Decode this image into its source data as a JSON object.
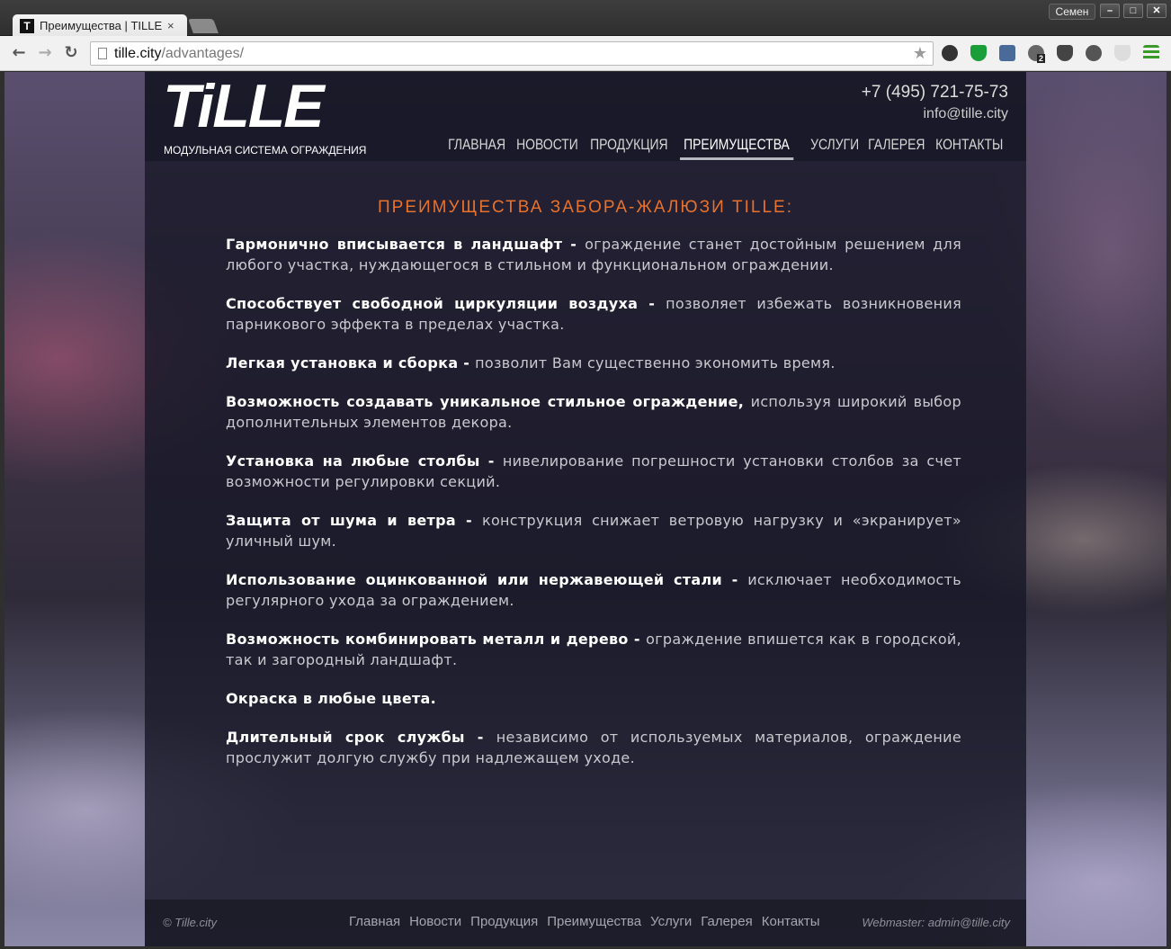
{
  "browser": {
    "tab_title": "Преимущества | TILLE",
    "tab_favicon": "T",
    "tab_close": "×",
    "user_name": "Семен",
    "url_host": "tille.city",
    "url_path": "/advantages/",
    "window_buttons": {
      "minimize": "–",
      "maximize": "□",
      "close": "✕"
    },
    "nav": {
      "back": "←",
      "forward": "→",
      "reload": "↻"
    },
    "star": "★",
    "extension_badge": "2"
  },
  "site": {
    "logo": "TiLLE",
    "slogan": "МОДУЛЬНАЯ СИСТЕМА ОГРАЖДЕНИЯ",
    "phone": "+7 (495) 721-75-73",
    "email": "info@tille.city",
    "nav": [
      "ГЛАВНАЯ",
      "НОВОСТИ",
      "ПРОДУКЦИЯ",
      "ПРЕИМУЩЕСТВА",
      "УСЛУГИ",
      "ГАЛЕРЕЯ",
      "КОНТАКТЫ"
    ],
    "nav_active": "ПРЕИМУЩЕСТВА",
    "accent_color": "#e8722c"
  },
  "content": {
    "title": "ПРЕИМУЩЕСТВА ЗАБОРА-ЖАЛЮЗИ TILLE:",
    "advantages": [
      {
        "bold": "Гармонично вписывается в ландшафт - ",
        "text": "ограждение станет достойным решением для любого участка, нуждающегося в стильном и функциональном ограждении."
      },
      {
        "bold": "Способствует свободной циркуляции воздуха - ",
        "text": "позволяет избежать возникновения парникового эффекта в пределах участка."
      },
      {
        "bold": "Легкая установка и сборка - ",
        "text": "позволит Вам существенно экономить время."
      },
      {
        "bold": "Возможность создавать уникальное стильное ограждение, ",
        "text": "используя широкий выбор дополнительных элементов декора."
      },
      {
        "bold": "Установка на любые столбы - ",
        "text": "нивелирование погрешности установки столбов за счет возможности регулировки секций."
      },
      {
        "bold": "Защита от шума и ветра - ",
        "text": "конструкция снижает ветровую нагрузку и «экранирует» уличный шум."
      },
      {
        "bold": "Использование оцинкованной или нержавеющей стали - ",
        "text": "исключает необходимость регулярного ухода за ограждением."
      },
      {
        "bold": "Возможность комбинировать металл и дерево - ",
        "text": "ограждение впишется как в городской, так и загородный ландшафт."
      },
      {
        "bold": "Окраска в любые цвета.",
        "text": ""
      },
      {
        "bold": "Длительный срок службы - ",
        "text": "независимо от используемых материалов, ограждение прослужит долгую службу при надлежащем уходе."
      }
    ]
  },
  "footer": {
    "copyright": "© Tille.city",
    "nav": [
      "Главная",
      "Новости",
      "Продукция",
      "Преимущества",
      "Услуги",
      "Галерея",
      "Контакты"
    ],
    "webmaster": "Webmaster: admin@tille.city"
  }
}
